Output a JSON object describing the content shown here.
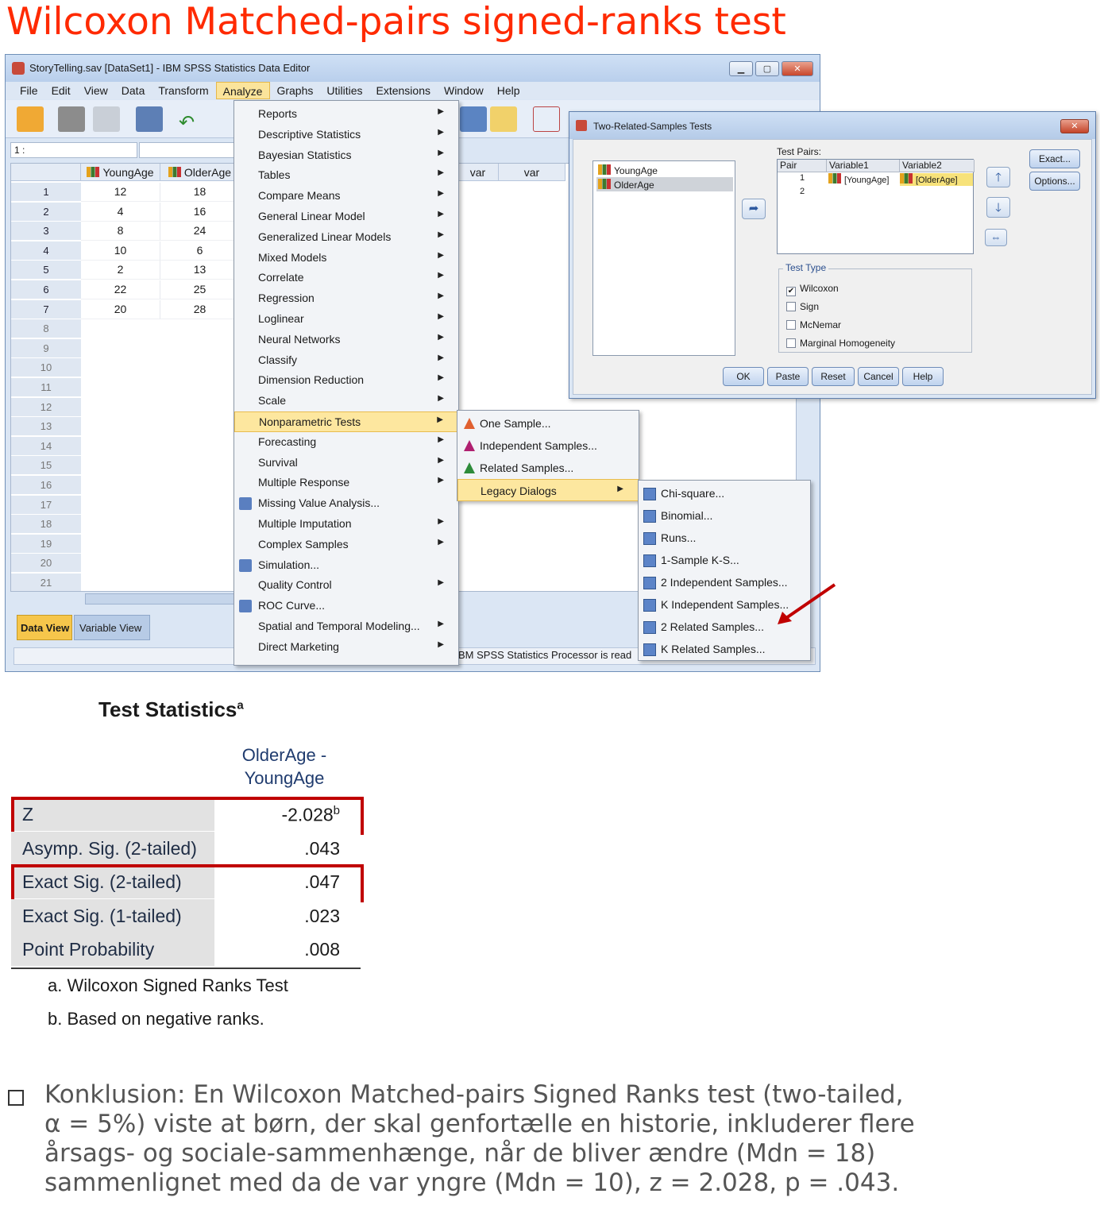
{
  "slide": {
    "title": "Wilcoxon Matched-pairs signed-ranks test"
  },
  "spss": {
    "window_title": "StoryTelling.sav [DataSet1] - IBM SPSS Statistics Data Editor",
    "menubar": [
      "File",
      "Edit",
      "View",
      "Data",
      "Transform",
      "Analyze",
      "Graphs",
      "Utilities",
      "Extensions",
      "Window",
      "Help"
    ],
    "active_menu": "Analyze",
    "cell_ref": "1 :",
    "columns": [
      "YoungAge",
      "OlderAge",
      "var",
      "var"
    ],
    "rows": [
      {
        "num": "1",
        "young": "12",
        "older": "18"
      },
      {
        "num": "2",
        "young": "4",
        "older": "16"
      },
      {
        "num": "3",
        "young": "8",
        "older": "24"
      },
      {
        "num": "4",
        "young": "10",
        "older": "6"
      },
      {
        "num": "5",
        "young": "2",
        "older": "13"
      },
      {
        "num": "6",
        "young": "22",
        "older": "25"
      },
      {
        "num": "7",
        "young": "20",
        "older": "28"
      }
    ],
    "empty_rows": [
      "8",
      "9",
      "10",
      "11",
      "12",
      "13",
      "14",
      "15",
      "16",
      "17",
      "18",
      "19",
      "20",
      "21"
    ],
    "tabs": {
      "data_view": "Data View",
      "variable_view": "Variable View"
    },
    "status": "BM SPSS Statistics Processor is read",
    "analyze_menu": [
      {
        "label": "Reports",
        "submenu": true
      },
      {
        "label": "Descriptive Statistics",
        "submenu": true
      },
      {
        "label": "Bayesian Statistics",
        "submenu": true
      },
      {
        "label": "Tables",
        "submenu": true
      },
      {
        "label": "Compare Means",
        "submenu": true
      },
      {
        "label": "General Linear Model",
        "submenu": true
      },
      {
        "label": "Generalized Linear Models",
        "submenu": true
      },
      {
        "label": "Mixed Models",
        "submenu": true
      },
      {
        "label": "Correlate",
        "submenu": true
      },
      {
        "label": "Regression",
        "submenu": true
      },
      {
        "label": "Loglinear",
        "submenu": true
      },
      {
        "label": "Neural Networks",
        "submenu": true
      },
      {
        "label": "Classify",
        "submenu": true
      },
      {
        "label": "Dimension Reduction",
        "submenu": true
      },
      {
        "label": "Scale",
        "submenu": true
      },
      {
        "label": "Nonparametric Tests",
        "submenu": true,
        "highlight": true
      },
      {
        "label": "Forecasting",
        "submenu": true
      },
      {
        "label": "Survival",
        "submenu": true
      },
      {
        "label": "Multiple Response",
        "submenu": true
      },
      {
        "label": "Missing Value Analysis...",
        "submenu": false,
        "icon": true
      },
      {
        "label": "Multiple Imputation",
        "submenu": true
      },
      {
        "label": "Complex Samples",
        "submenu": true
      },
      {
        "label": "Simulation...",
        "submenu": false,
        "icon": true
      },
      {
        "label": "Quality Control",
        "submenu": true
      },
      {
        "label": "ROC Curve...",
        "submenu": false,
        "icon": true
      },
      {
        "label": "Spatial and Temporal Modeling...",
        "submenu": true
      },
      {
        "label": "Direct Marketing",
        "submenu": true
      }
    ],
    "nonparametric_menu": [
      {
        "label": "One Sample...",
        "color": "#e06030"
      },
      {
        "label": "Independent Samples...",
        "color": "#b02070"
      },
      {
        "label": "Related Samples...",
        "color": "#2e8b3a"
      },
      {
        "label": "Legacy Dialogs",
        "highlight": true
      }
    ],
    "legacy_menu": [
      "Chi-square...",
      "Binomial...",
      "Runs...",
      "1-Sample K-S...",
      "2 Independent Samples...",
      "K Independent Samples...",
      "2 Related Samples...",
      "K Related Samples..."
    ]
  },
  "dialog": {
    "title": "Two-Related-Samples Tests",
    "close": "✕",
    "variables": [
      "YoungAge",
      "OlderAge"
    ],
    "test_pairs_label": "Test Pairs:",
    "pairs_headers": [
      "Pair",
      "Variable1",
      "Variable2"
    ],
    "pairs": [
      {
        "pair": "1",
        "var1": "[YoungAge]",
        "var2": "[OlderAge]"
      },
      {
        "pair": "2",
        "var1": "",
        "var2": ""
      }
    ],
    "test_type_label": "Test Type",
    "test_types": [
      {
        "label": "Wilcoxon",
        "checked": "✔"
      },
      {
        "label": "Sign",
        "checked": ""
      },
      {
        "label": "McNemar",
        "checked": ""
      },
      {
        "label": "Marginal Homogeneity",
        "checked": ""
      }
    ],
    "side_buttons": [
      "Exact...",
      "Options..."
    ],
    "bottom_buttons": [
      "OK",
      "Paste",
      "Reset",
      "Cancel",
      "Help"
    ]
  },
  "test_statistics": {
    "title": "Test Statistics",
    "title_sup": "a",
    "col_header_line1": "OlderAge -",
    "col_header_line2": "YoungAge",
    "rows": [
      {
        "label": "Z",
        "value": "-2.028",
        "sup": "b",
        "boxed": true
      },
      {
        "label": "Asymp. Sig. (2-tailed)",
        "value": ".043",
        "sup": "",
        "boxed": false
      },
      {
        "label": "Exact Sig. (2-tailed)",
        "value": ".047",
        "sup": "",
        "boxed": true
      },
      {
        "label": "Exact Sig. (1-tailed)",
        "value": ".023",
        "sup": "",
        "boxed": false
      },
      {
        "label": "Point Probability",
        "value": ".008",
        "sup": "",
        "boxed": false
      }
    ],
    "footnotes": [
      "a. Wilcoxon Signed Ranks Test",
      "b. Based on negative ranks."
    ]
  },
  "conclusion": {
    "lead": "Konklusion: ",
    "text": "En Wilcoxon Matched-pairs Signed Ranks test (two-tailed, α = 5%) viste at børn, der skal genfortælle en historie, inkluderer flere årsags- og sociale-sammenhænge, når de bliver ændre (Mdn = 18) sammenlignet med da de var yngre (Mdn = 10), z = 2.028, p = .043."
  },
  "colors": {
    "title": "#ff2a00",
    "highlight": "#fde79f",
    "red_box": "#c00000"
  }
}
